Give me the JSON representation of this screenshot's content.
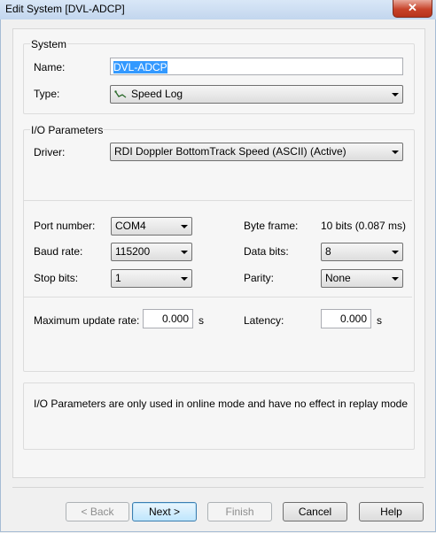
{
  "window": {
    "title": "Edit System [DVL-ADCP]",
    "close_glyph": "✕"
  },
  "system": {
    "group_label": "System",
    "name_label": "Name:",
    "name_value": "DVL-ADCP",
    "type_label": "Type:",
    "type_value": "Speed Log",
    "type_icon": "speed-log-icon"
  },
  "io": {
    "group_label": "I/O Parameters",
    "driver_label": "Driver:",
    "driver_value": "RDI Doppler BottomTrack Speed (ASCII) (Active)",
    "port_label": "Port number:",
    "port_value": "COM4",
    "baud_label": "Baud rate:",
    "baud_value": "115200",
    "stop_label": "Stop bits:",
    "stop_value": "1",
    "byte_frame_label": "Byte frame:",
    "byte_frame_value": "10 bits (0.087 ms)",
    "data_bits_label": "Data bits:",
    "data_bits_value": "8",
    "parity_label": "Parity:",
    "parity_value": "None",
    "max_rate_label": "Maximum update rate:",
    "max_rate_value": "0.000",
    "max_rate_unit": "s",
    "latency_label": "Latency:",
    "latency_value": "0.000",
    "latency_unit": "s"
  },
  "info_text": "I/O Parameters are only used in online mode and have no effect in replay mode",
  "buttons": {
    "back": "< Back",
    "next": "Next >",
    "finish": "Finish",
    "cancel": "Cancel",
    "help": "Help"
  }
}
